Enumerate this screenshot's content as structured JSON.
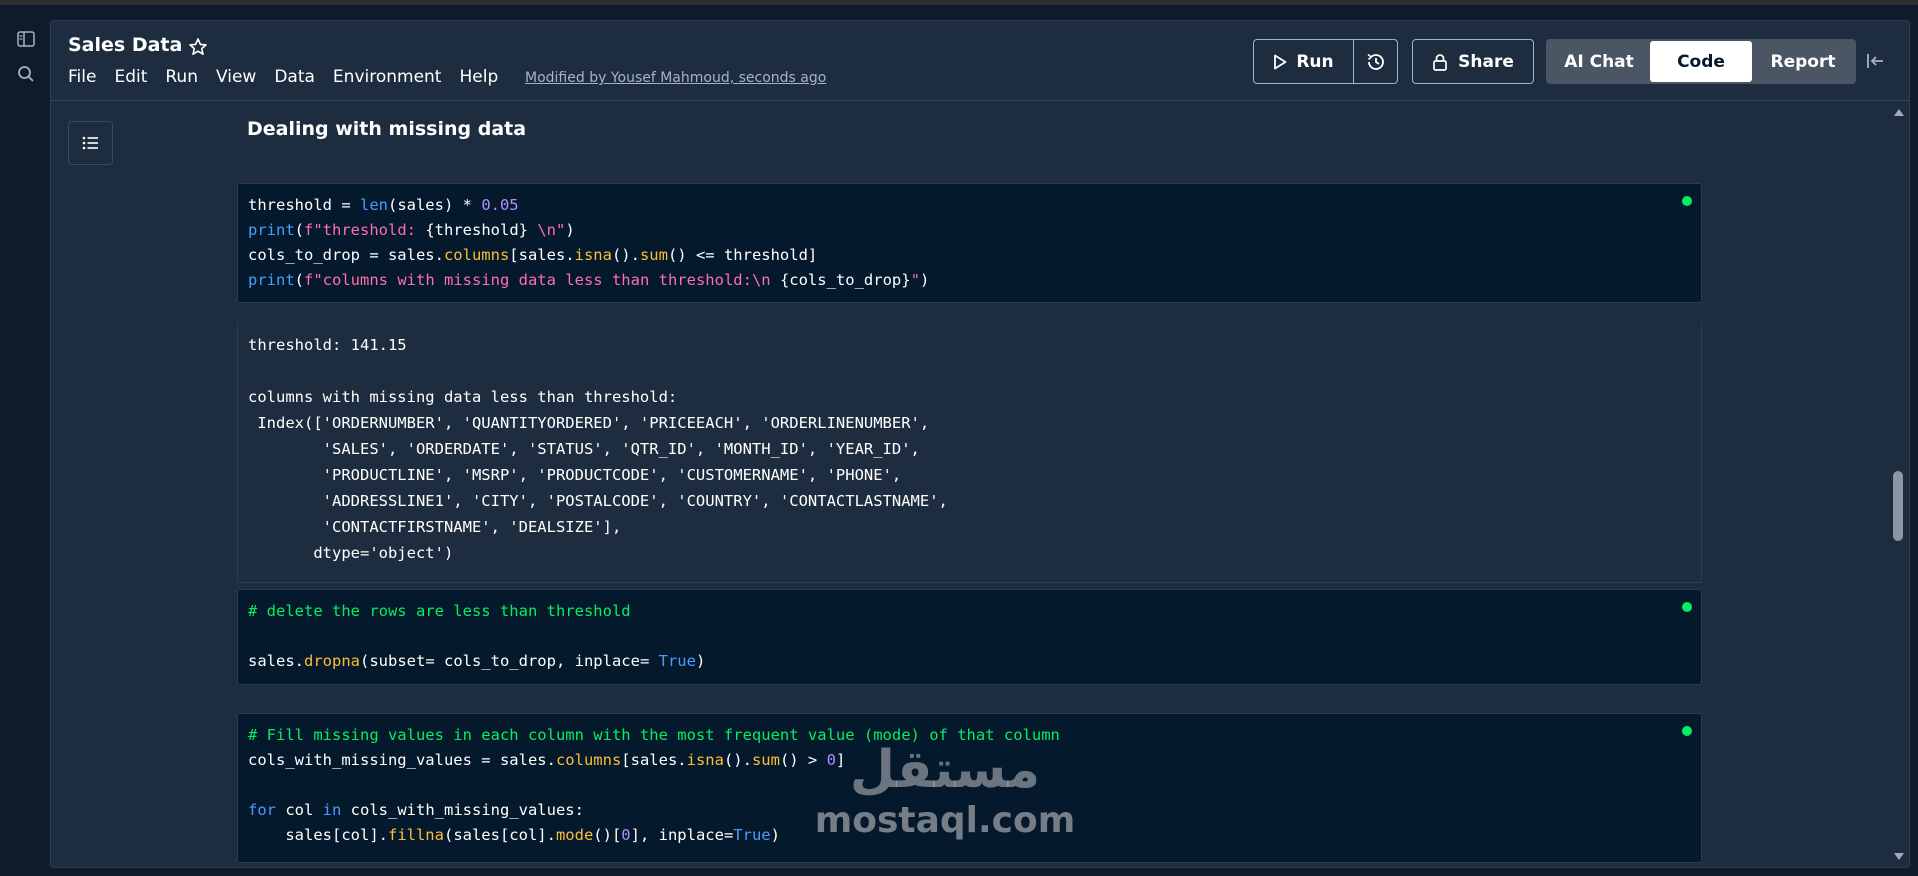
{
  "notebook": {
    "title": "Sales Data",
    "menu": [
      "File",
      "Edit",
      "Run",
      "View",
      "Data",
      "Environment",
      "Help"
    ],
    "modified": "Modified by Yousef Mahmoud, seconds ago"
  },
  "toolbar": {
    "run_label": "Run",
    "share_label": "Share",
    "views": [
      "AI Chat",
      "Code",
      "Report"
    ],
    "active_view": "Code"
  },
  "section": {
    "title": "Dealing with missing data"
  },
  "cells": [
    {
      "lines": [
        [
          [
            "threshold = ",
            ""
          ],
          [
            "len",
            "kw"
          ],
          [
            "(sales) * ",
            ""
          ],
          [
            "0.05",
            "num"
          ]
        ],
        [
          [
            "print",
            "kw"
          ],
          [
            "(",
            ""
          ],
          [
            "f\"threshold: ",
            "str"
          ],
          [
            "{threshold}",
            ""
          ],
          [
            " \\n\"",
            "str"
          ],
          [
            ")",
            ""
          ]
        ],
        [
          [
            "cols_to_drop = sales.",
            ""
          ],
          [
            "columns",
            "fn"
          ],
          [
            "[sales.",
            ""
          ],
          [
            "isna",
            "fn"
          ],
          [
            "().",
            ""
          ],
          [
            "sum",
            "fn"
          ],
          [
            "() <= threshold]",
            ""
          ]
        ],
        [
          [
            "print",
            "kw"
          ],
          [
            "(",
            ""
          ],
          [
            "f\"columns with missing data less than threshold:\\n ",
            "str"
          ],
          [
            "{cols_to_drop}",
            ""
          ],
          [
            "\"",
            "str"
          ],
          [
            ")",
            ""
          ]
        ]
      ],
      "output": [
        "threshold: 141.15",
        "",
        "columns with missing data less than threshold:",
        " Index(['ORDERNUMBER', 'QUANTITYORDERED', 'PRICEEACH', 'ORDERLINENUMBER',",
        "        'SALES', 'ORDERDATE', 'STATUS', 'QTR_ID', 'MONTH_ID', 'YEAR_ID',",
        "        'PRODUCTLINE', 'MSRP', 'PRODUCTCODE', 'CUSTOMERNAME', 'PHONE',",
        "        'ADDRESSLINE1', 'CITY', 'POSTALCODE', 'COUNTRY', 'CONTACTLASTNAME',",
        "        'CONTACTFIRSTNAME', 'DEALSIZE'],",
        "       dtype='object')"
      ]
    },
    {
      "lines": [
        [
          [
            "# delete the rows are less than threshold",
            "cmt"
          ]
        ],
        [
          [
            "",
            ""
          ]
        ],
        [
          [
            "sales.",
            ""
          ],
          [
            "dropna",
            "fn"
          ],
          [
            "(subset= cols_to_drop, inplace= ",
            ""
          ],
          [
            "True",
            "kw"
          ],
          [
            ")",
            ""
          ]
        ]
      ]
    },
    {
      "lines": [
        [
          [
            "# Fill missing values in each column with the most frequent value (mode) of that column",
            "cmt"
          ]
        ],
        [
          [
            "cols_with_missing_values = sales.",
            ""
          ],
          [
            "columns",
            "fn"
          ],
          [
            "[sales.",
            ""
          ],
          [
            "isna",
            "fn"
          ],
          [
            "().",
            ""
          ],
          [
            "sum",
            "fn"
          ],
          [
            "() > ",
            ""
          ],
          [
            "0",
            "num"
          ],
          [
            "]",
            ""
          ]
        ],
        [
          [
            "",
            ""
          ]
        ],
        [
          [
            "for",
            "kw"
          ],
          [
            " col ",
            ""
          ],
          [
            "in",
            "kw"
          ],
          [
            " cols_with_missing_values:",
            ""
          ]
        ],
        [
          [
            "    sales[col].",
            ""
          ],
          [
            "fillna",
            "fn"
          ],
          [
            "(sales[col].",
            ""
          ],
          [
            "mode",
            "fn"
          ],
          [
            "()[",
            ""
          ],
          [
            "0",
            "num"
          ],
          [
            "], inplace=",
            ""
          ],
          [
            "True",
            "kw"
          ],
          [
            ")",
            ""
          ]
        ]
      ]
    }
  ],
  "watermark": {
    "arabic": "مستقل",
    "latin": "mostaql.com"
  }
}
